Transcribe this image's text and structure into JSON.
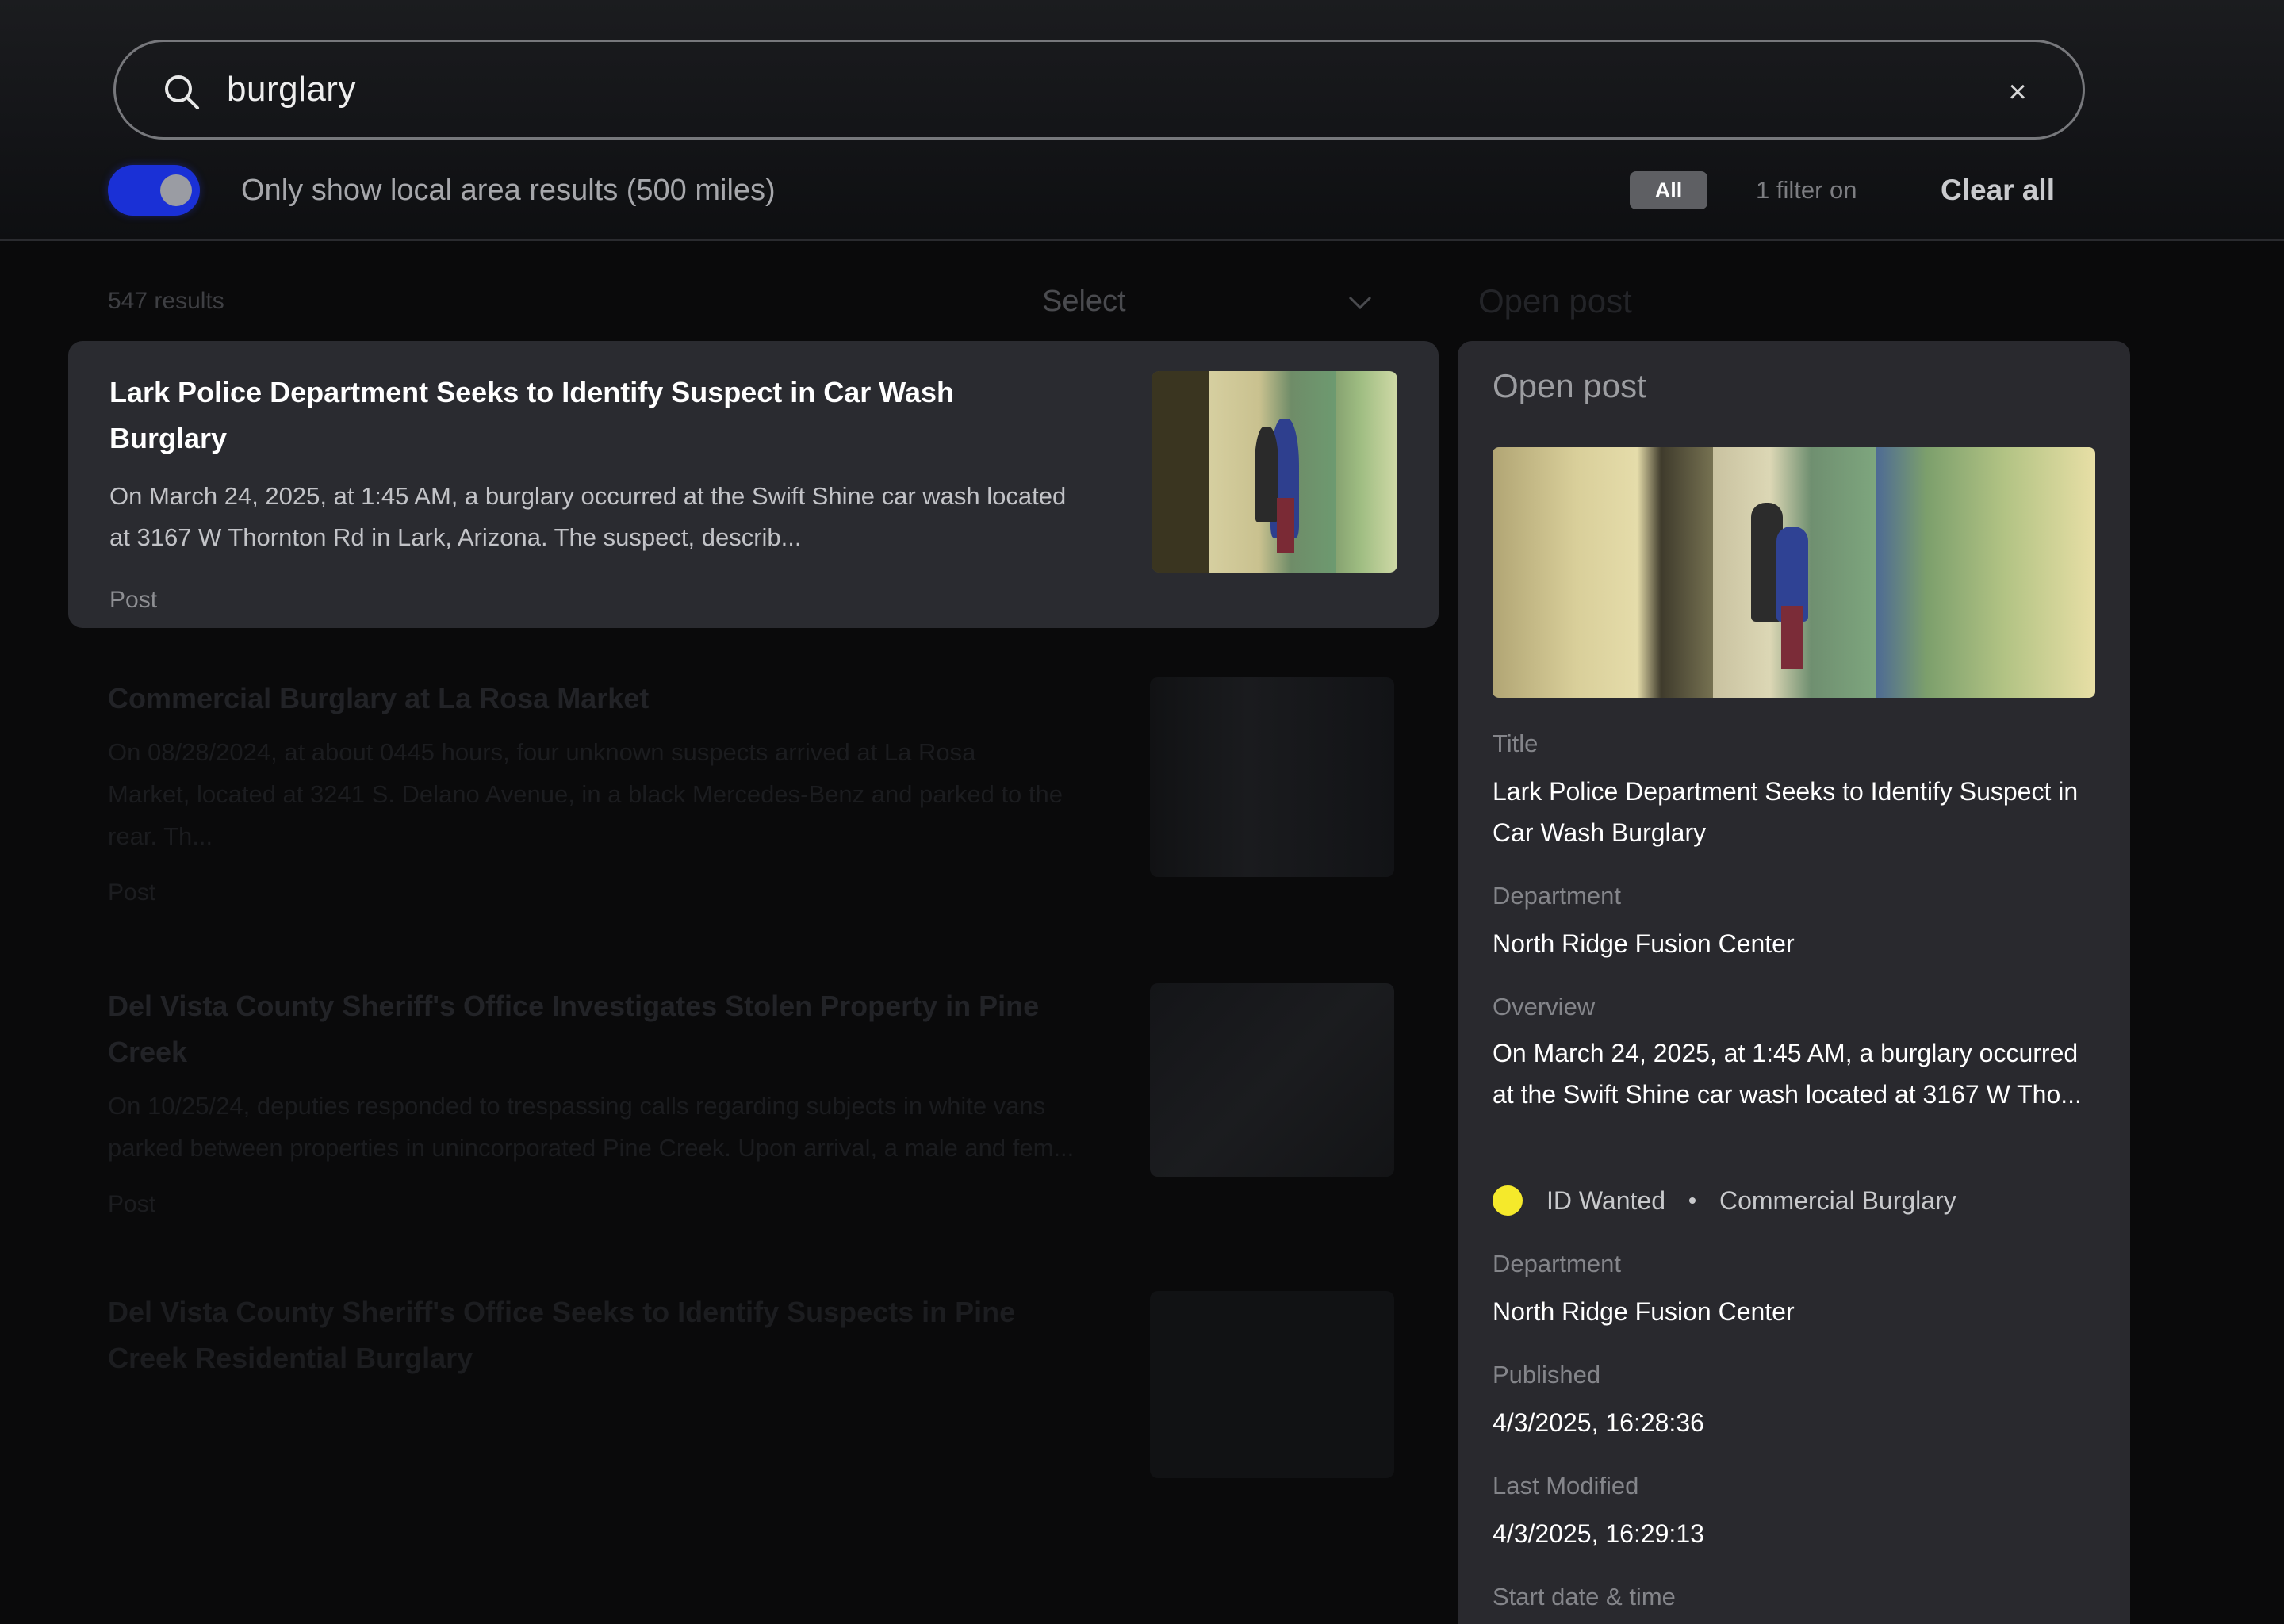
{
  "search": {
    "query": "burglary",
    "clear_symbol": "×"
  },
  "filters": {
    "local_toggle_label": "Only show local area results (500 miles)",
    "local_toggle_on": true,
    "all_chip": "All",
    "filter_count": "1 filter on",
    "clear_all": "Clear all"
  },
  "list": {
    "results_count": "547 results",
    "sort_select": "Select",
    "open_post_heading": "Open post",
    "items": [
      {
        "title": "Lark Police Department Seeks to Identify Suspect in Car Wash Burglary",
        "description": "On March 24, 2025, at 1:45 AM, a burglary occurred at the Swift Shine car wash located at 3167 W Thornton Rd in Lark, Arizona. The suspect, describ...",
        "type": "Post"
      },
      {
        "title": "Commercial Burglary at La Rosa Market",
        "description": "On 08/28/2024, at about 0445 hours, four unknown suspects arrived at La Rosa\nMarket, located at 3241 S. Delano Avenue, in a black Mercedes-Benz and parked to the rear. Th...",
        "type": "Post"
      },
      {
        "title": "Del Vista County Sheriff's Office Investigates Stolen Property in Pine Creek",
        "description": "On 10/25/24, deputies responded to trespassing calls regarding subjects in white vans parked between properties in unincorporated Pine Creek. Upon arrival, a male and fem...",
        "type": "Post"
      },
      {
        "title": "Del Vista County Sheriff's Office Seeks to Identify Suspects in Pine Creek Residential Burglary",
        "description": "",
        "type": ""
      }
    ]
  },
  "panel": {
    "heading": "Open post",
    "title_label": "Title",
    "title_value": "Lark Police Department Seeks to Identify Suspect in Car Wash Burglary",
    "department_label": "Department",
    "department_value": "North Ridge Fusion Center",
    "overview_label": "Overview",
    "overview_value": "On March 24, 2025, at 1:45 AM, a burglary occurred at the Swift Shine car wash located at 3167 W Tho...",
    "tags": [
      "ID Wanted",
      "Commercial Burglary"
    ],
    "status_color": "#f5e92b",
    "department2_label": "Department",
    "department2_value": "North Ridge Fusion Center",
    "published_label": "Published",
    "published_value": "4/3/2025, 16:28:36",
    "modified_label": "Last Modified",
    "modified_value": "4/3/2025, 16:29:13",
    "start_label": "Start date & time"
  },
  "colors": {
    "toggle_accent": "#1a30d6",
    "card_bg": "#2a2b30",
    "panel_bg": "#29292e"
  }
}
